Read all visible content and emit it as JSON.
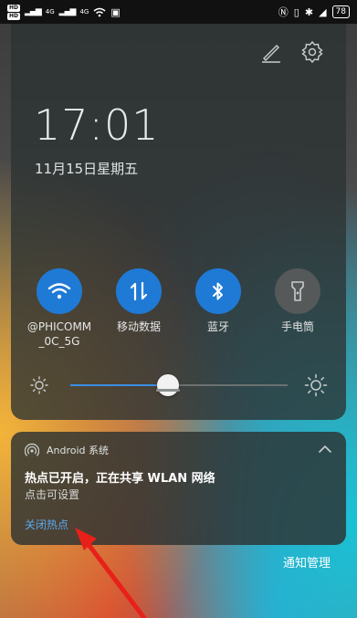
{
  "status_bar": {
    "hd1": "HD",
    "hd2": "HD",
    "net1": "4G",
    "net2": "4G",
    "battery": "78"
  },
  "shade": {
    "time": "17:01",
    "date": "11月15日星期五",
    "toggles": [
      {
        "label": "@PHICOMM\n_0C_5G",
        "icon": "wifi-icon",
        "state": "on"
      },
      {
        "label": "移动数据",
        "icon": "mobile-data-icon",
        "state": "on"
      },
      {
        "label": "蓝牙",
        "icon": "bluetooth-icon",
        "state": "on"
      },
      {
        "label": "手电筒",
        "icon": "flashlight-icon",
        "state": "off"
      }
    ],
    "brightness": 0.45
  },
  "notification": {
    "app_name": "Android 系统",
    "title": "热点已开启，正在共享 WLAN 网络",
    "subtitle": "点击可设置",
    "action": "关闭热点"
  },
  "manage_label": "通知管理",
  "colors": {
    "accent": "#1f7ad6",
    "link": "#5aa9f2",
    "annotation_arrow": "#e8201a"
  }
}
